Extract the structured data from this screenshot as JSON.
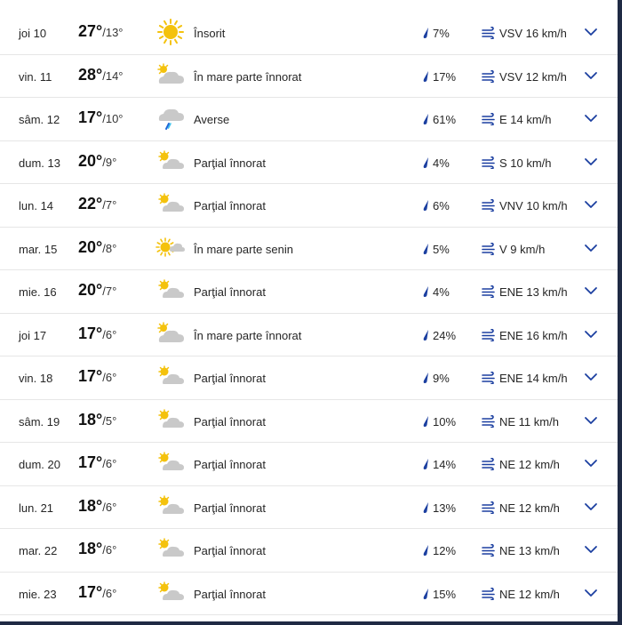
{
  "colors": {
    "accent": "#1b3fa0",
    "sun": "#f4c20d",
    "cloud": "#c9c9c9",
    "rain": "#1e66d8"
  },
  "days": [
    {
      "day": "joi 10",
      "high": "27°",
      "low": "/13°",
      "icon": "sun-icon",
      "condition": "Însorit",
      "precip": "7%",
      "wind": "VSV 16 km/h"
    },
    {
      "day": "vin. 11",
      "high": "28°",
      "low": "/14°",
      "icon": "mostly-cloudy-icon",
      "condition": "În mare parte înnorat",
      "precip": "17%",
      "wind": "VSV 12 km/h"
    },
    {
      "day": "sâm. 12",
      "high": "17°",
      "low": "/10°",
      "icon": "showers-icon",
      "condition": "Averse",
      "precip": "61%",
      "wind": "E 14 km/h"
    },
    {
      "day": "dum. 13",
      "high": "20°",
      "low": "/9°",
      "icon": "partly-cloudy-icon",
      "condition": "Parţial înnorat",
      "precip": "4%",
      "wind": "S 10 km/h"
    },
    {
      "day": "lun. 14",
      "high": "22°",
      "low": "/7°",
      "icon": "partly-cloudy-icon",
      "condition": "Parţial înnorat",
      "precip": "6%",
      "wind": "VNV 10 km/h"
    },
    {
      "day": "mar. 15",
      "high": "20°",
      "low": "/8°",
      "icon": "mostly-sunny-icon",
      "condition": "În mare parte senin",
      "precip": "5%",
      "wind": "V 9 km/h"
    },
    {
      "day": "mie. 16",
      "high": "20°",
      "low": "/7°",
      "icon": "partly-cloudy-icon",
      "condition": "Parţial înnorat",
      "precip": "4%",
      "wind": "ENE 13 km/h"
    },
    {
      "day": "joi 17",
      "high": "17°",
      "low": "/6°",
      "icon": "mostly-cloudy-icon",
      "condition": "În mare parte înnorat",
      "precip": "24%",
      "wind": "ENE 16 km/h"
    },
    {
      "day": "vin. 18",
      "high": "17°",
      "low": "/6°",
      "icon": "partly-cloudy-icon",
      "condition": "Parţial înnorat",
      "precip": "9%",
      "wind": "ENE 14 km/h"
    },
    {
      "day": "sâm. 19",
      "high": "18°",
      "low": "/5°",
      "icon": "partly-cloudy-icon",
      "condition": "Parţial înnorat",
      "precip": "10%",
      "wind": "NE 11 km/h"
    },
    {
      "day": "dum. 20",
      "high": "17°",
      "low": "/6°",
      "icon": "partly-cloudy-icon",
      "condition": "Parţial înnorat",
      "precip": "14%",
      "wind": "NE 12 km/h"
    },
    {
      "day": "lun. 21",
      "high": "18°",
      "low": "/6°",
      "icon": "partly-cloudy-icon",
      "condition": "Parţial înnorat",
      "precip": "13%",
      "wind": "NE 12 km/h"
    },
    {
      "day": "mar. 22",
      "high": "18°",
      "low": "/6°",
      "icon": "partly-cloudy-icon",
      "condition": "Parţial înnorat",
      "precip": "12%",
      "wind": "NE 13 km/h"
    },
    {
      "day": "mie. 23",
      "high": "17°",
      "low": "/6°",
      "icon": "partly-cloudy-icon",
      "condition": "Parţial înnorat",
      "precip": "15%",
      "wind": "NE 12 km/h"
    }
  ]
}
